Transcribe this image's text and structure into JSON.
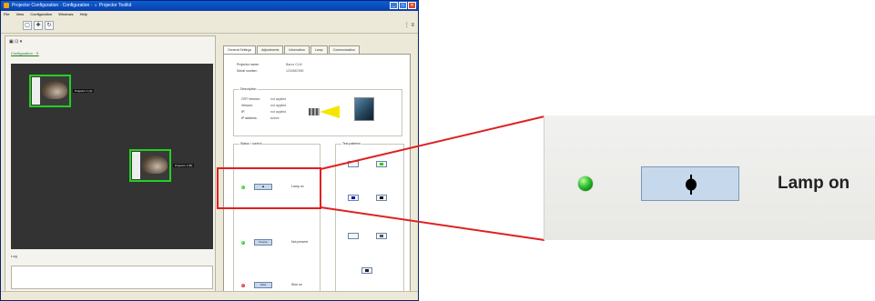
{
  "window": {
    "title": "Projector Configuration · Configuration · ☼ Projector Toolkit",
    "menu": [
      "File",
      "View",
      "Configuration",
      "Windows",
      "Help"
    ]
  },
  "left_panel": {
    "config_tab": "Configuration · ✕",
    "projectors": [
      {
        "label": "Projector 1 (A)"
      },
      {
        "label": "Projector 2 (B)"
      }
    ],
    "log_title": "Log"
  },
  "right_panel": {
    "tabs": [
      "General Settings",
      "Adjustments",
      "Information",
      "Lamp",
      "Communication"
    ],
    "fields": [
      {
        "label": "Projector name:",
        "value": "Barco CLM"
      },
      {
        "label": "Serial number:",
        "value": "1234567890"
      }
    ],
    "description_title": "Description",
    "description": [
      {
        "label": "CRT Version:",
        "value": "not applied"
      },
      {
        "label": "Version:",
        "value": "not applied"
      },
      {
        "label": "IP:",
        "value": "not applied"
      },
      {
        "label": "IP address:",
        "value": "Active"
      }
    ],
    "status_control_title": "Status / control",
    "test_pattern_title": "Test patterns",
    "controls": [
      {
        "button": "◆",
        "label": "Lamp on",
        "led": "green"
      },
      {
        "button": "Freeze",
        "label": "Not present",
        "led": "green"
      },
      {
        "button": "Shut",
        "label": "Shut on",
        "led": "red"
      }
    ]
  },
  "zoom": {
    "label": "Lamp on",
    "led_color": "#2fbf2f",
    "button_icon": "lamp-power-icon"
  },
  "colors": {
    "highlight": "#e02020",
    "canvas": "#333333",
    "projector_frame": "#22d022",
    "button_blue": "#c6d8ec"
  }
}
